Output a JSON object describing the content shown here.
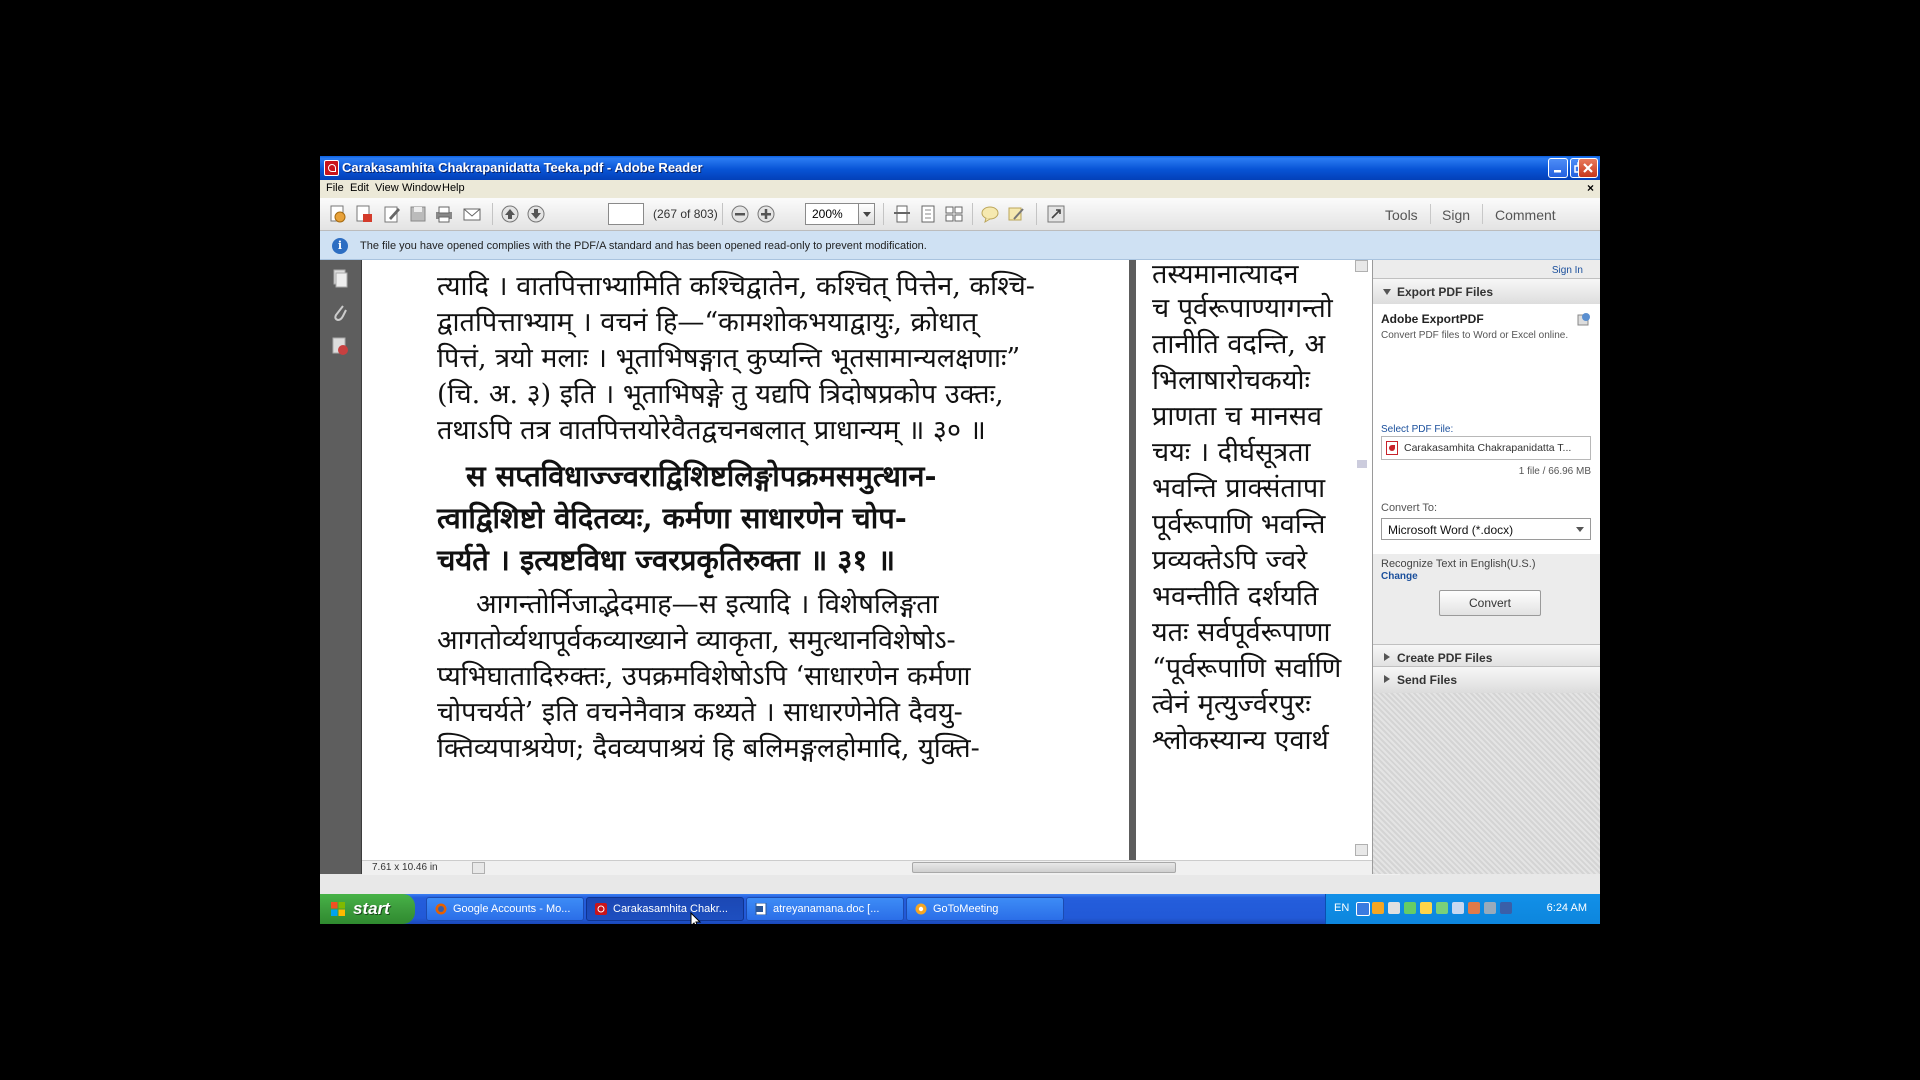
{
  "window": {
    "title": "Carakasamhita Chakrapanidatta Teeka.pdf - Adobe Reader"
  },
  "menu": [
    "File",
    "Edit",
    "View",
    "Window",
    "Help"
  ],
  "toolbar": {
    "page_value": "",
    "page_count": "(267 of 803)",
    "zoom": "200%",
    "tools_label": "Tools",
    "sign_label": "Sign",
    "comment_label": "Comment"
  },
  "infobar": {
    "message": "The file you have opened complies with the PDF/A standard and has been opened read-only to prevent modification."
  },
  "document": {
    "left_lines": [
      "त्यादि । वातपित्ताभ्यामिति कश्चिद्वातेन, कश्चित् पित्तेन, कश्चि-",
      "द्वातपित्ताभ्याम् । वचनं हि—“कामशोकभयाद्वायुः, क्रोधात्",
      "पित्तं, त्रयो मलाः । भूताभिषङ्गात् कुप्यन्ति भूतसामान्यलक्षणाः”",
      "(चि. अ. ३) इति । भूताभिषङ्गे तु यद्यपि त्रिदोषप्रकोप उक्तः,",
      "तथाऽपि तत्र वातपित्तयोरेवैतद्वचनबलात् प्राधान्यम् ॥ ३० ॥",
      "स सप्तविधाज्ज्वराद्विशिष्टलिङ्गोपक्रमसमुत्थान-",
      "त्वाद्विशिष्टो वेदितव्यः, कर्मणा साधारणेन चोप-",
      "चर्यते । इत्यष्टविधा ज्वरप्रकृतिरुक्ता ॥ ३१ ॥",
      "आगन्तोर्निजाद्भेदमाह—स इत्यादि । विशेषलिङ्गता",
      "आगतोर्व्यथापूर्वकव्याख्याने व्याकृता, समुत्थानविशेषोऽ-",
      "प्यभिघातादिरुक्तः, उपक्रमविशेषोऽपि ‘साधारणेन कर्मणा",
      "चोपचर्यते’ इति वचनेनैवात्र कथ्यते । साधारणेनेति दैवयु-",
      "क्तिव्यपाश्रयेण; दैवव्यपाश्रयं हि बलिमङ्गलहोमादि, युक्ति-"
    ],
    "right_lines": [
      "तस्यमानात्यादन",
      "च पूर्वरूपाण्यागन्तो",
      "तानीति वदन्ति, अ",
      "भिलाषारोचकयोः",
      "प्राणता च मानसव",
      "चयः । दीर्घसूत्रता",
      "भवन्ति प्राक्संतापा",
      "पूर्वरूपाणि भवन्ति",
      "प्रव्यक्तेऽपि ज्वरे",
      "भवन्तीति दर्शयति",
      "यतः सर्वपूर्वरूपाणा",
      "“पूर्वरूपाणि सर्वाणि",
      "त्वेनं मृत्युर्ज्वरपुरः",
      "श्लोकस्यान्य एवार्थ"
    ],
    "page_size": "7.61 x 10.46 in"
  },
  "panel": {
    "sign_in": "Sign In",
    "export_header": "Export PDF Files",
    "export_title": "Adobe ExportPDF",
    "export_desc": "Convert PDF files to Word or Excel online.",
    "select_label": "Select PDF File:",
    "selected_file": "Carakasamhita Chakrapanidatta T...",
    "file_info": "1 file / 66.96 MB",
    "convert_to_label": "Convert To:",
    "convert_to_value": "Microsoft Word (*.docx)",
    "recognize_text": "Recognize Text in English(U.S.)",
    "change_link": "Change",
    "convert_button": "Convert",
    "create_header": "Create PDF Files",
    "send_header": "Send Files"
  },
  "taskbar": {
    "start_label": "start",
    "tasks": [
      "Google Accounts - Mo...",
      "Carakasamhita Chakr...",
      "atreyanamana.doc [...",
      "GoToMeeting"
    ],
    "language": "EN",
    "clock": "6:24 AM"
  },
  "colors": {
    "title_bar": "#0854d6",
    "taskbar": "#245edc",
    "start_green": "#3c9c3c",
    "info_bar": "#cfe1f3",
    "link_blue": "#1a4f9c"
  }
}
